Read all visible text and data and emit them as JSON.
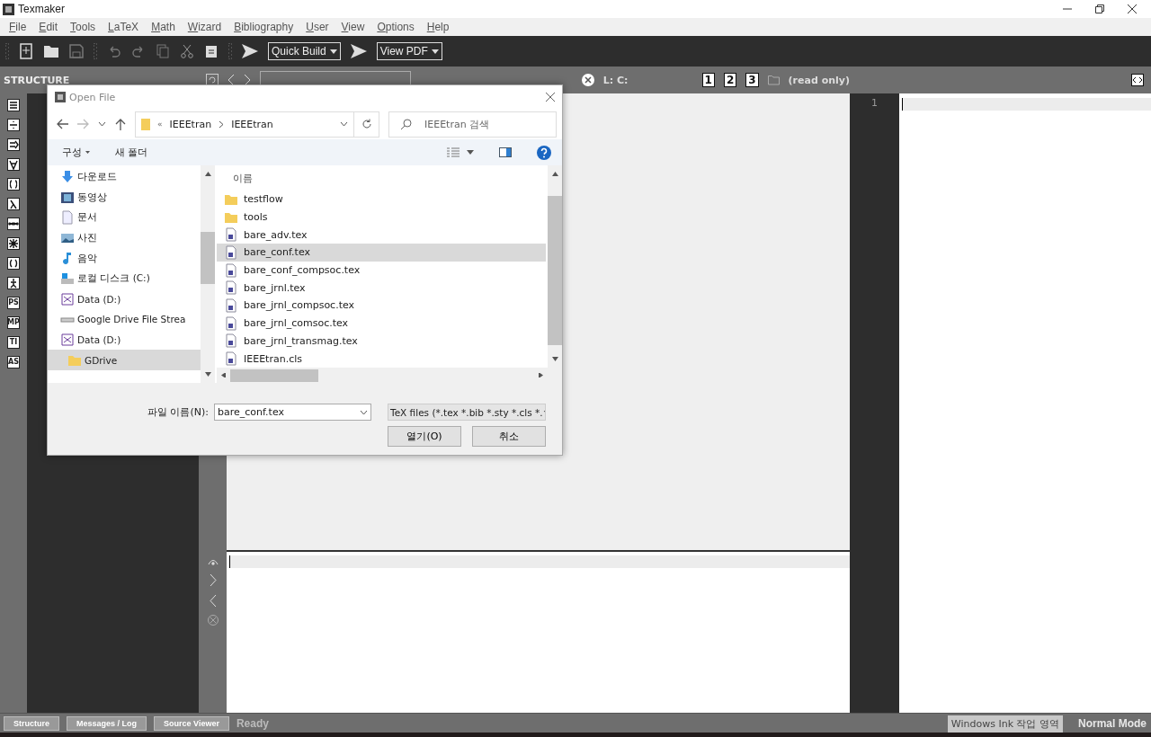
{
  "window": {
    "title": "Texmaker"
  },
  "menu": [
    "File",
    "Edit",
    "Tools",
    "LaTeX",
    "Math",
    "Wizard",
    "Bibliography",
    "User",
    "View",
    "Options",
    "Help"
  ],
  "toolbar": {
    "build_command": "Quick Build",
    "view_command": "View PDF"
  },
  "structure": {
    "title": "STRUCTURE"
  },
  "symbol_panels": [
    "PS",
    "MP",
    "TI",
    "AS"
  ],
  "editor_bar": {
    "position": "L: C:",
    "views": [
      "1",
      "2",
      "3"
    ],
    "file_state": "(read only)"
  },
  "line_numbers": [
    "1"
  ],
  "status_bar": {
    "tabs": [
      "Structure",
      "Messages / Log",
      "Source Viewer"
    ],
    "status": "Ready",
    "mode": "Normal Mode",
    "tooltip": "Windows Ink 작업 영역"
  },
  "dialog": {
    "title": "Open File",
    "address": {
      "overflow": "«",
      "path": [
        "IEEEtran",
        "IEEEtran"
      ]
    },
    "search": {
      "placeholder": "IEEEtran 검색"
    },
    "commands": {
      "organize": "구성",
      "new_folder": "새 폴더"
    },
    "nav": [
      {
        "label": "다운로드",
        "kind": "download",
        "selected": false
      },
      {
        "label": "동영상",
        "kind": "video",
        "selected": false
      },
      {
        "label": "문서",
        "kind": "document",
        "selected": false
      },
      {
        "label": "사진",
        "kind": "picture",
        "selected": false
      },
      {
        "label": "음악",
        "kind": "music",
        "selected": false
      },
      {
        "label": "로컬 디스크 (C:)",
        "kind": "disk",
        "selected": false
      },
      {
        "label": "Data (D:)",
        "kind": "card",
        "selected": false
      },
      {
        "label": "Google Drive File Strea",
        "kind": "drive",
        "selected": false
      },
      {
        "label": "Data (D:)",
        "kind": "card",
        "selected": false,
        "children": [
          {
            "label": "GDrive",
            "kind": "folder",
            "selected": true
          }
        ]
      }
    ],
    "files_header": "이름",
    "files": [
      {
        "name": "testflow",
        "kind": "folder",
        "selected": false
      },
      {
        "name": "tools",
        "kind": "folder",
        "selected": false
      },
      {
        "name": "bare_adv.tex",
        "kind": "tex",
        "selected": false
      },
      {
        "name": "bare_conf.tex",
        "kind": "tex",
        "selected": true
      },
      {
        "name": "bare_conf_compsoc.tex",
        "kind": "tex",
        "selected": false
      },
      {
        "name": "bare_jrnl.tex",
        "kind": "tex",
        "selected": false
      },
      {
        "name": "bare_jrnl_compsoc.tex",
        "kind": "tex",
        "selected": false
      },
      {
        "name": "bare_jrnl_comsoc.tex",
        "kind": "tex",
        "selected": false
      },
      {
        "name": "bare_jrnl_transmag.tex",
        "kind": "tex",
        "selected": false
      },
      {
        "name": "IEEEtran.cls",
        "kind": "tex",
        "selected": false
      }
    ],
    "file_name_label": "파일 이름(N):",
    "file_name": "bare_conf.tex",
    "filter": "TeX files (*.tex *.bib *.sty *.cls *.",
    "buttons": [
      "열기(O)",
      "취소"
    ]
  }
}
